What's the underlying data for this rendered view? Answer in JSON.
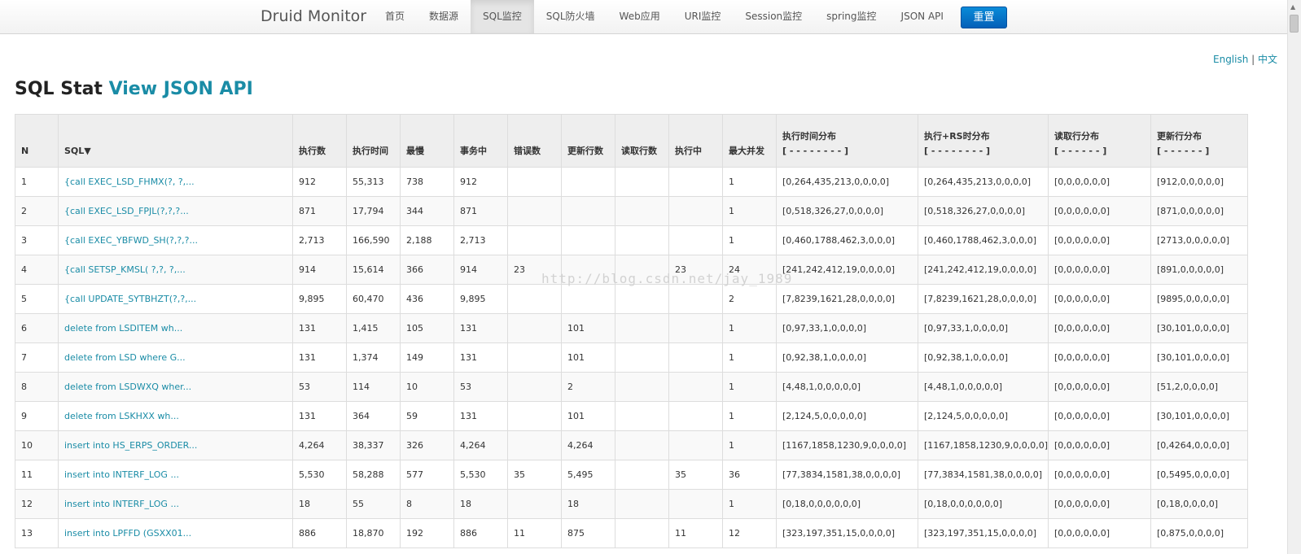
{
  "nav": {
    "brand": "Druid Monitor",
    "items": [
      "首页",
      "数据源",
      "SQL监控",
      "SQL防火墙",
      "Web应用",
      "URI监控",
      "Session监控",
      "spring监控",
      "JSON API"
    ],
    "active_index": 2,
    "reset_label": "重置"
  },
  "lang": {
    "english": "English",
    "separator": "|",
    "chinese": "中文"
  },
  "title": {
    "prefix": "SQL Stat",
    "link": "View JSON API"
  },
  "watermark": "http://blog.csdn.net/jay_1989",
  "table": {
    "headers": [
      {
        "label": "N"
      },
      {
        "label": "SQL▼"
      },
      {
        "label": "执行数"
      },
      {
        "label": "执行时间"
      },
      {
        "label": "最慢"
      },
      {
        "label": "事务中"
      },
      {
        "label": "错误数"
      },
      {
        "label": "更新行数"
      },
      {
        "label": "读取行数"
      },
      {
        "label": "执行中"
      },
      {
        "label": "最大并发"
      },
      {
        "label": "执行时间分布",
        "sub": "[ - - - - - - - - ]"
      },
      {
        "label": "执行+RS时分布",
        "sub": "[ - - - - - - - - ]"
      },
      {
        "label": "读取行分布",
        "sub": "[ - - - - - - ]"
      },
      {
        "label": "更新行分布",
        "sub": "[ - - - - - - ]"
      }
    ],
    "rows": [
      [
        "1",
        "{call EXEC_LSD_FHMX(?, ?,...",
        "912",
        "55,313",
        "738",
        "912",
        "",
        "",
        "",
        "",
        "1",
        "[0,264,435,213,0,0,0,0]",
        "[0,264,435,213,0,0,0,0]",
        "[0,0,0,0,0,0]",
        "[912,0,0,0,0,0]"
      ],
      [
        "2",
        "{call EXEC_LSD_FPJL(?,?,?...",
        "871",
        "17,794",
        "344",
        "871",
        "",
        "",
        "",
        "",
        "1",
        "[0,518,326,27,0,0,0,0]",
        "[0,518,326,27,0,0,0,0]",
        "[0,0,0,0,0,0]",
        "[871,0,0,0,0,0]"
      ],
      [
        "3",
        "{call EXEC_YBFWD_SH(?,?,?...",
        "2,713",
        "166,590",
        "2,188",
        "2,713",
        "",
        "",
        "",
        "",
        "1",
        "[0,460,1788,462,3,0,0,0]",
        "[0,460,1788,462,3,0,0,0]",
        "[0,0,0,0,0,0]",
        "[2713,0,0,0,0,0]"
      ],
      [
        "4",
        "{call SETSP_KMSL( ?,?, ?,...",
        "914",
        "15,614",
        "366",
        "914",
        "23",
        "",
        "",
        "23",
        "24",
        "[241,242,412,19,0,0,0,0]",
        "[241,242,412,19,0,0,0,0]",
        "[0,0,0,0,0,0]",
        "[891,0,0,0,0,0]"
      ],
      [
        "5",
        "{call UPDATE_SYTBHZT(?,?,...",
        "9,895",
        "60,470",
        "436",
        "9,895",
        "",
        "",
        "",
        "",
        "2",
        "[7,8239,1621,28,0,0,0,0]",
        "[7,8239,1621,28,0,0,0,0]",
        "[0,0,0,0,0,0]",
        "[9895,0,0,0,0,0]"
      ],
      [
        "6",
        "delete from LSDITEM wh...",
        "131",
        "1,415",
        "105",
        "131",
        "",
        "101",
        "",
        "",
        "1",
        "[0,97,33,1,0,0,0,0]",
        "[0,97,33,1,0,0,0,0]",
        "[0,0,0,0,0,0]",
        "[30,101,0,0,0,0]"
      ],
      [
        "7",
        "delete from LSD where G...",
        "131",
        "1,374",
        "149",
        "131",
        "",
        "101",
        "",
        "",
        "1",
        "[0,92,38,1,0,0,0,0]",
        "[0,92,38,1,0,0,0,0]",
        "[0,0,0,0,0,0]",
        "[30,101,0,0,0,0]"
      ],
      [
        "8",
        "delete from LSDWXQ wher...",
        "53",
        "114",
        "10",
        "53",
        "",
        "2",
        "",
        "",
        "1",
        "[4,48,1,0,0,0,0,0]",
        "[4,48,1,0,0,0,0,0]",
        "[0,0,0,0,0,0]",
        "[51,2,0,0,0,0]"
      ],
      [
        "9",
        "delete from LSKHXX wh...",
        "131",
        "364",
        "59",
        "131",
        "",
        "101",
        "",
        "",
        "1",
        "[2,124,5,0,0,0,0,0]",
        "[2,124,5,0,0,0,0,0]",
        "[0,0,0,0,0,0]",
        "[30,101,0,0,0,0]"
      ],
      [
        "10",
        "insert into HS_ERPS_ORDER...",
        "4,264",
        "38,337",
        "326",
        "4,264",
        "",
        "4,264",
        "",
        "",
        "1",
        "[1167,1858,1230,9,0,0,0,0]",
        "[1167,1858,1230,9,0,0,0,0]",
        "[0,0,0,0,0,0]",
        "[0,4264,0,0,0,0]"
      ],
      [
        "11",
        "insert into INTERF_LOG ...",
        "5,530",
        "58,288",
        "577",
        "5,530",
        "35",
        "5,495",
        "",
        "35",
        "36",
        "[77,3834,1581,38,0,0,0,0]",
        "[77,3834,1581,38,0,0,0,0]",
        "[0,0,0,0,0,0]",
        "[0,5495,0,0,0,0]"
      ],
      [
        "12",
        "insert into INTERF_LOG ...",
        "18",
        "55",
        "8",
        "18",
        "",
        "18",
        "",
        "",
        "1",
        "[0,18,0,0,0,0,0,0]",
        "[0,18,0,0,0,0,0,0]",
        "[0,0,0,0,0,0]",
        "[0,18,0,0,0,0]"
      ],
      [
        "13",
        "insert into LPFFD (GSXX01...",
        "886",
        "18,870",
        "192",
        "886",
        "11",
        "875",
        "",
        "11",
        "12",
        "[323,197,351,15,0,0,0,0]",
        "[323,197,351,15,0,0,0,0]",
        "[0,0,0,0,0,0]",
        "[0,875,0,0,0,0]"
      ]
    ]
  }
}
